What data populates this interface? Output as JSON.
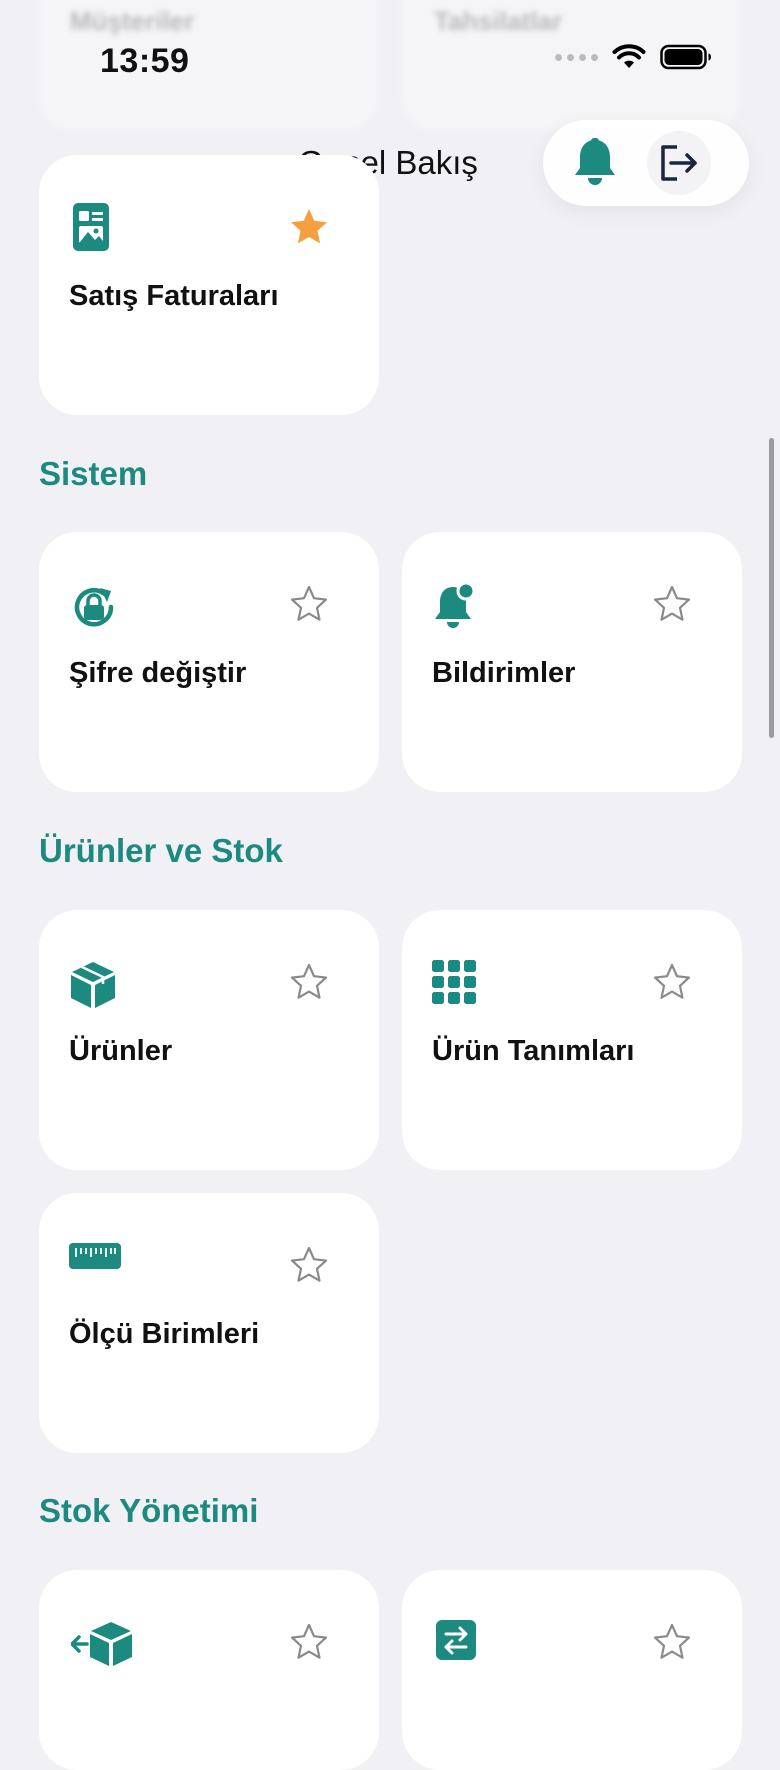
{
  "background_tabs": [
    "Müşteriler",
    "Tahsilatlar"
  ],
  "status_bar": {
    "time": "13:59"
  },
  "nav": {
    "title": "Genel Bakış"
  },
  "accent_color": "#1c8a7e",
  "favorite_color": "#f5a040",
  "favorites_card": {
    "label": "Satış Faturaları",
    "icon": "invoice-image-icon",
    "starred": true
  },
  "sections": [
    {
      "title": "Sistem",
      "cards": [
        {
          "label": "Şifre değiştir",
          "icon": "lock-reset-icon",
          "starred": false
        },
        {
          "label": "Bildirimler",
          "icon": "notification-bell-icon",
          "starred": false
        }
      ]
    },
    {
      "title": "Ürünler ve Stok",
      "cards": [
        {
          "label": "Ürünler",
          "icon": "box-icon",
          "starred": false
        },
        {
          "label": "Ürün Tanımları",
          "icon": "grid-icon",
          "starred": false
        },
        {
          "label": "Ölçü Birimleri",
          "icon": "ruler-icon",
          "starred": false
        }
      ]
    },
    {
      "title": "Stok Yönetimi",
      "cards": [
        {
          "label": "",
          "icon": "box-return-icon",
          "starred": false
        },
        {
          "label": "",
          "icon": "transfer-icon",
          "starred": false
        }
      ]
    }
  ]
}
